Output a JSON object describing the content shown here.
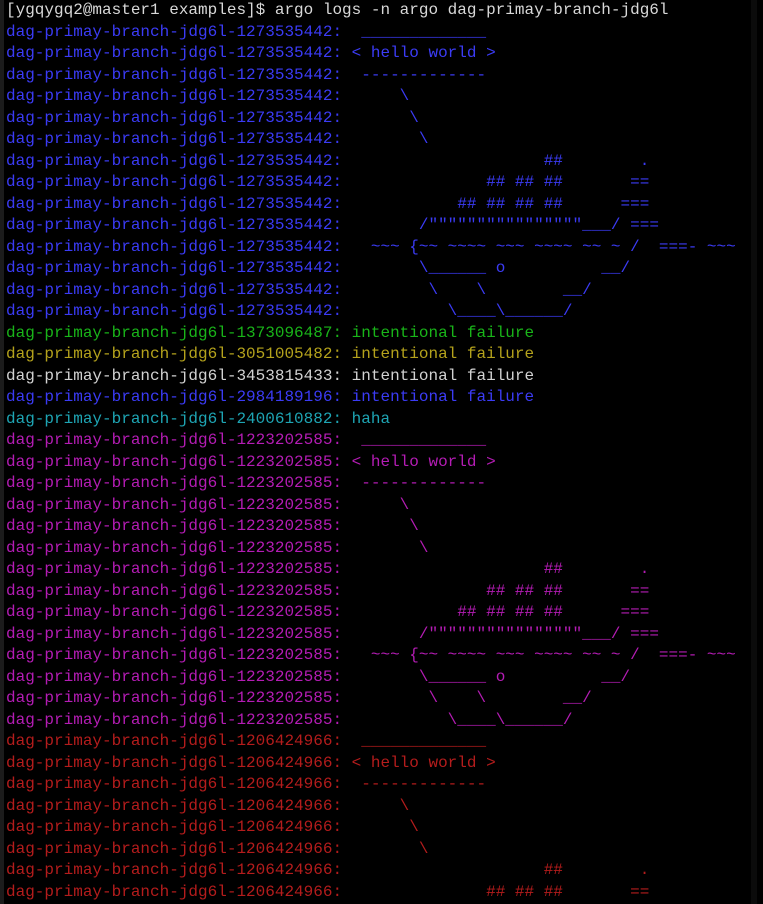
{
  "terminal": {
    "prompt": "[ygqygq2@master1 examples]$ argo logs -n argo dag-primay-branch-jdg6l",
    "colors": {
      "blue": "#3b3bf5",
      "green": "#19b419",
      "yellow": "#b4a21c",
      "white": "#d2d2d2",
      "cyan": "#1ea5b4",
      "magenta": "#b41cb4",
      "red": "#b41c1c",
      "background": "#000000"
    },
    "lines": [
      {
        "prefix": "dag-primay-branch-jdg6l-1273535442:",
        "text": "  _____________",
        "color": "blue"
      },
      {
        "prefix": "dag-primay-branch-jdg6l-1273535442:",
        "text": " < hello world >",
        "color": "blue"
      },
      {
        "prefix": "dag-primay-branch-jdg6l-1273535442:",
        "text": "  -------------",
        "color": "blue"
      },
      {
        "prefix": "dag-primay-branch-jdg6l-1273535442:",
        "text": "      \\",
        "color": "blue"
      },
      {
        "prefix": "dag-primay-branch-jdg6l-1273535442:",
        "text": "       \\",
        "color": "blue"
      },
      {
        "prefix": "dag-primay-branch-jdg6l-1273535442:",
        "text": "        \\",
        "color": "blue"
      },
      {
        "prefix": "dag-primay-branch-jdg6l-1273535442:",
        "text": "                     ##        .",
        "color": "blue"
      },
      {
        "prefix": "dag-primay-branch-jdg6l-1273535442:",
        "text": "               ## ## ##       ==",
        "color": "blue"
      },
      {
        "prefix": "dag-primay-branch-jdg6l-1273535442:",
        "text": "            ## ## ## ##      ===",
        "color": "blue"
      },
      {
        "prefix": "dag-primay-branch-jdg6l-1273535442:",
        "text": "        /\"\"\"\"\"\"\"\"\"\"\"\"\"\"\"\"___/ ===",
        "color": "blue"
      },
      {
        "prefix": "dag-primay-branch-jdg6l-1273535442:",
        "text": "   ~~~ {~~ ~~~~ ~~~ ~~~~ ~~ ~ /  ===- ~~~",
        "color": "blue"
      },
      {
        "prefix": "dag-primay-branch-jdg6l-1273535442:",
        "text": "        \\______ o          __/",
        "color": "blue"
      },
      {
        "prefix": "dag-primay-branch-jdg6l-1273535442:",
        "text": "         \\    \\        __/",
        "color": "blue"
      },
      {
        "prefix": "dag-primay-branch-jdg6l-1273535442:",
        "text": "           \\____\\______/",
        "color": "blue"
      },
      {
        "prefix": "dag-primay-branch-jdg6l-1373096487:",
        "text": " intentional failure",
        "color": "green"
      },
      {
        "prefix": "dag-primay-branch-jdg6l-3051005482:",
        "text": " intentional failure",
        "color": "yellow"
      },
      {
        "prefix": "dag-primay-branch-jdg6l-3453815433:",
        "text": " intentional failure",
        "color": "white"
      },
      {
        "prefix": "dag-primay-branch-jdg6l-2984189196:",
        "text": " intentional failure",
        "color": "blue"
      },
      {
        "prefix": "dag-primay-branch-jdg6l-2400610882:",
        "text": " haha",
        "color": "cyan"
      },
      {
        "prefix": "dag-primay-branch-jdg6l-1223202585:",
        "text": "  _____________",
        "color": "magenta"
      },
      {
        "prefix": "dag-primay-branch-jdg6l-1223202585:",
        "text": " < hello world >",
        "color": "magenta"
      },
      {
        "prefix": "dag-primay-branch-jdg6l-1223202585:",
        "text": "  -------------",
        "color": "magenta"
      },
      {
        "prefix": "dag-primay-branch-jdg6l-1223202585:",
        "text": "      \\",
        "color": "magenta"
      },
      {
        "prefix": "dag-primay-branch-jdg6l-1223202585:",
        "text": "       \\",
        "color": "magenta"
      },
      {
        "prefix": "dag-primay-branch-jdg6l-1223202585:",
        "text": "        \\",
        "color": "magenta"
      },
      {
        "prefix": "dag-primay-branch-jdg6l-1223202585:",
        "text": "                     ##        .",
        "color": "magenta"
      },
      {
        "prefix": "dag-primay-branch-jdg6l-1223202585:",
        "text": "               ## ## ##       ==",
        "color": "magenta"
      },
      {
        "prefix": "dag-primay-branch-jdg6l-1223202585:",
        "text": "            ## ## ## ##      ===",
        "color": "magenta"
      },
      {
        "prefix": "dag-primay-branch-jdg6l-1223202585:",
        "text": "        /\"\"\"\"\"\"\"\"\"\"\"\"\"\"\"\"___/ ===",
        "color": "magenta"
      },
      {
        "prefix": "dag-primay-branch-jdg6l-1223202585:",
        "text": "   ~~~ {~~ ~~~~ ~~~ ~~~~ ~~ ~ /  ===- ~~~",
        "color": "magenta"
      },
      {
        "prefix": "dag-primay-branch-jdg6l-1223202585:",
        "text": "        \\______ o          __/",
        "color": "magenta"
      },
      {
        "prefix": "dag-primay-branch-jdg6l-1223202585:",
        "text": "         \\    \\        __/",
        "color": "magenta"
      },
      {
        "prefix": "dag-primay-branch-jdg6l-1223202585:",
        "text": "           \\____\\______/",
        "color": "magenta"
      },
      {
        "prefix": "dag-primay-branch-jdg6l-1206424966:",
        "text": "  _____________",
        "color": "red"
      },
      {
        "prefix": "dag-primay-branch-jdg6l-1206424966:",
        "text": " < hello world >",
        "color": "red"
      },
      {
        "prefix": "dag-primay-branch-jdg6l-1206424966:",
        "text": "  -------------",
        "color": "red"
      },
      {
        "prefix": "dag-primay-branch-jdg6l-1206424966:",
        "text": "      \\",
        "color": "red"
      },
      {
        "prefix": "dag-primay-branch-jdg6l-1206424966:",
        "text": "       \\",
        "color": "red"
      },
      {
        "prefix": "dag-primay-branch-jdg6l-1206424966:",
        "text": "        \\",
        "color": "red"
      },
      {
        "prefix": "dag-primay-branch-jdg6l-1206424966:",
        "text": "                     ##        .",
        "color": "red"
      },
      {
        "prefix": "dag-primay-branch-jdg6l-1206424966:",
        "text": "               ## ## ##       ==",
        "color": "red"
      }
    ]
  }
}
